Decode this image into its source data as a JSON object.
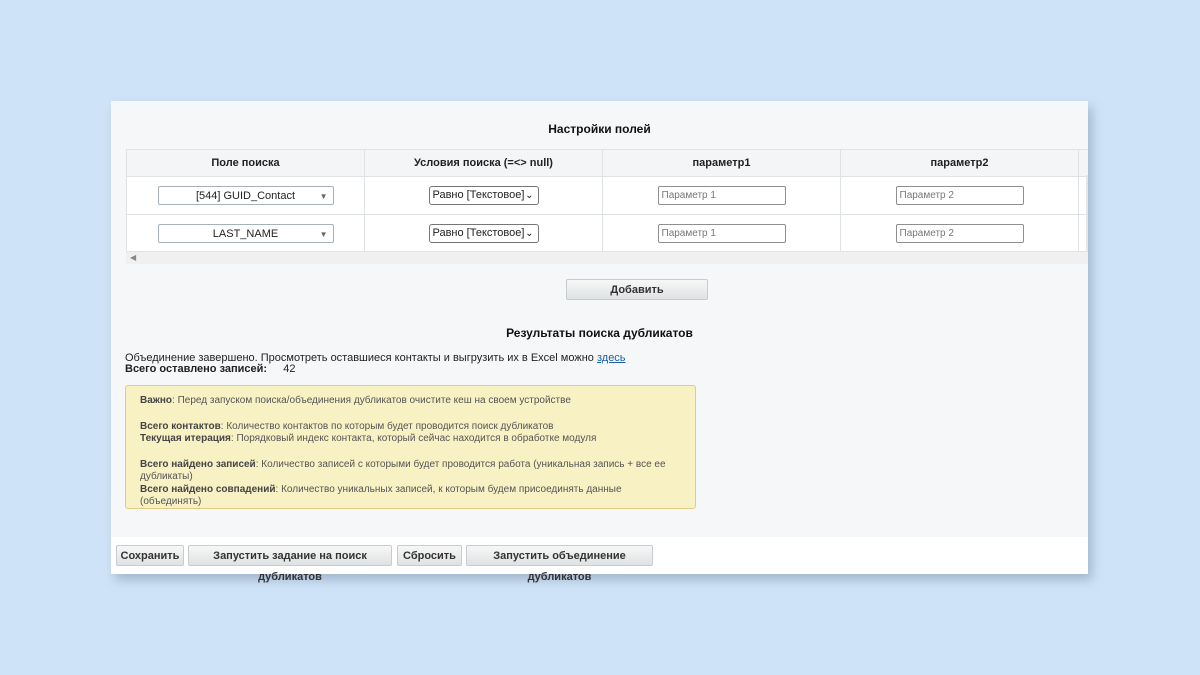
{
  "settings": {
    "title": "Настройки полей",
    "columns": [
      "Поле поиска",
      "Условия поиска (=<> null)",
      "параметр1",
      "параметр2"
    ],
    "rows": [
      {
        "field": "[544] GUID_Contact",
        "condition": "Равно [Текстовое]",
        "param1_placeholder": "Параметр 1",
        "param2_placeholder": "Параметр 2"
      },
      {
        "field": "LAST_NAME",
        "condition": "Равно [Текстовое]",
        "param1_placeholder": "Параметр 1",
        "param2_placeholder": "Параметр 2"
      }
    ],
    "add_button": "Добавить"
  },
  "results": {
    "title": "Результаты поиска дубликатов",
    "message": "Объединение завершено. Просмотреть оставшиеся контакты и выгрузить их в Excel можно",
    "link_text": "здесь",
    "total_label": "Всего оставлено записей:",
    "total_value": "42"
  },
  "notice": {
    "important_label": "Важно",
    "important_text": ": Перед запуском поиска/объединения дубликатов очистите кеш на своем устройстве",
    "contacts_label": "Всего контактов",
    "contacts_text": ": Количество контактов по которым будет проводится поиск дубликатов",
    "iteration_label": "Текущая итерация",
    "iteration_text": ": Порядковый индекс контакта, который сейчас находится в обработке модуля",
    "records_label": "Всего найдено записей",
    "records_text": ": Количество записей с которыми будет проводится работа (уникальная запись + все ее дубликаты)",
    "matches_label": "Всего найдено совпадений",
    "matches_text": ": Количество уникальных записей, к которым будем присоединять данные (объединять)"
  },
  "footer": {
    "save": "Сохранить",
    "run_search": "Запустить задание на поиск дубликатов",
    "reset": "Сбросить",
    "run_merge": "Запустить объединение дубликатов"
  },
  "colors": {
    "background": "#cfe3f8",
    "notice_bg": "#f8f1c4",
    "link": "#1a5ea8"
  }
}
